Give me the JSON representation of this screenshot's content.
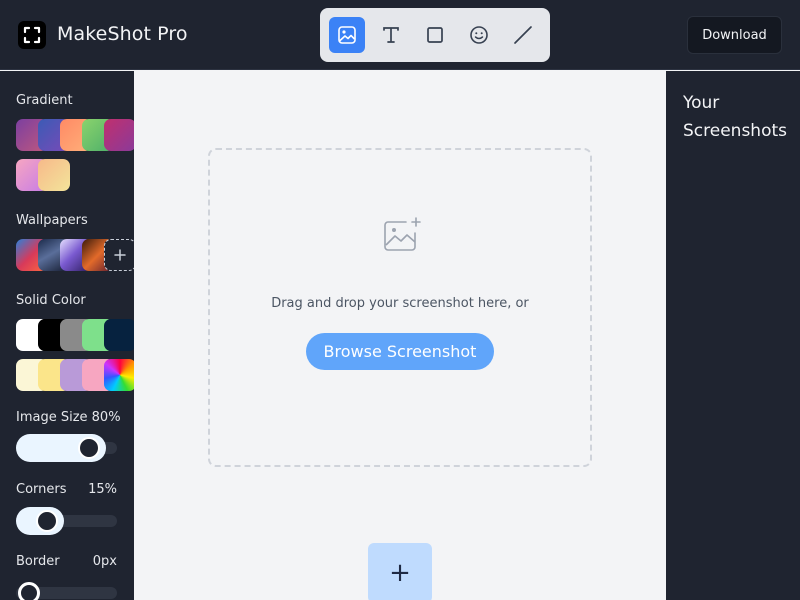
{
  "app": {
    "title": "MakeShot Pro"
  },
  "toolbar": {
    "tools": [
      {
        "name": "image-tool",
        "icon": "image-icon",
        "active": true
      },
      {
        "name": "text-tool",
        "icon": "text-icon",
        "active": false
      },
      {
        "name": "rectangle-tool",
        "icon": "square-icon",
        "active": false
      },
      {
        "name": "emoji-tool",
        "icon": "smiley-icon",
        "active": false
      },
      {
        "name": "line-tool",
        "icon": "line-icon",
        "active": false
      }
    ]
  },
  "header": {
    "download_label": "Download"
  },
  "sidebar": {
    "gradient_label": "Gradient",
    "wallpapers_label": "Wallpapers",
    "solid_color_label": "Solid Color",
    "image_size_label": "Image Size 80%",
    "image_size_value": 0.8,
    "corners_label": "Corners",
    "corners_value": "15%",
    "corners_fraction": 0.15,
    "border_label": "Border",
    "border_value": "0px",
    "border_fraction": 0,
    "solid_colors": [
      "#ffffff",
      "#000000",
      "#8a8a8a",
      "#7ee08b",
      "#06223f",
      "#fbf6d6",
      "#fbe58a",
      "#b99ad8",
      "#f7a6c1"
    ]
  },
  "canvas": {
    "drop_text": "Drag and drop your screenshot here, or",
    "browse_label": "Browse Screenshot",
    "add_label": "+"
  },
  "right_panel": {
    "title": "Your Screenshots"
  }
}
